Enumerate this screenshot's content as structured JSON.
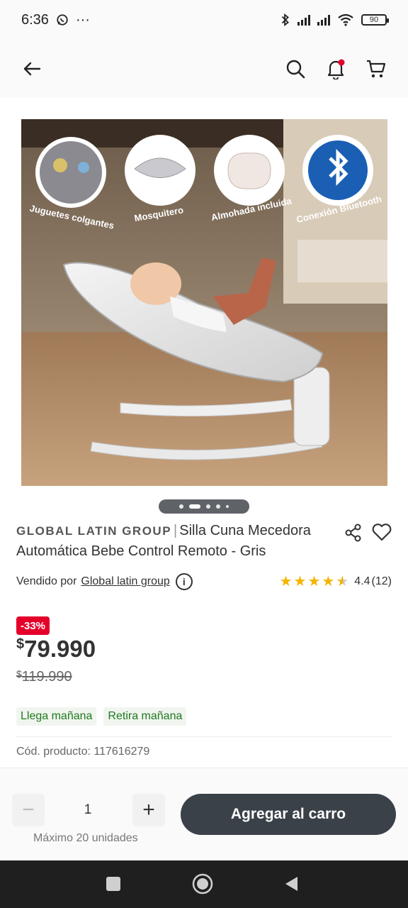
{
  "status_bar": {
    "time": "6:36",
    "more": "···",
    "battery": "90"
  },
  "header": {
    "back_icon": "arrow-left-icon",
    "search_icon": "search-icon",
    "notification_icon": "bell-icon",
    "cart_icon": "cart-icon",
    "notification_dot_color": "#e4002b"
  },
  "gallery": {
    "feature_labels": [
      "Juguetes colgantes",
      "Mosquitero",
      "Almohada incluida",
      "Conexión Bluetooth"
    ],
    "dots_count": 5,
    "active_dot": 1
  },
  "product": {
    "brand": "GLOBAL LATIN GROUP",
    "separator": "|",
    "name": "Silla Cuna Mecedora Automática Bebe Control Remoto - Gris",
    "sold_by_label": "Vendido por",
    "seller": "Global latin group",
    "rating_value": 4.4,
    "rating_text": "4.4",
    "reviews": "(12)",
    "discount": "-33%",
    "currency": "$",
    "price": "79.990",
    "old_price": "119.990",
    "delivery": [
      "Llega mañana",
      "Retira mañana"
    ],
    "sku_text": "Cód. producto: 117616279"
  },
  "cart_bar": {
    "minus": "−",
    "quantity": "1",
    "plus": "+",
    "max_units": "Máximo 20 unidades",
    "add_label": "Agregar al carro"
  },
  "colors": {
    "accent_dark": "#3a4148",
    "discount": "#e4002b",
    "delivery_text": "#1f7a1f",
    "star": "#f4b400"
  }
}
